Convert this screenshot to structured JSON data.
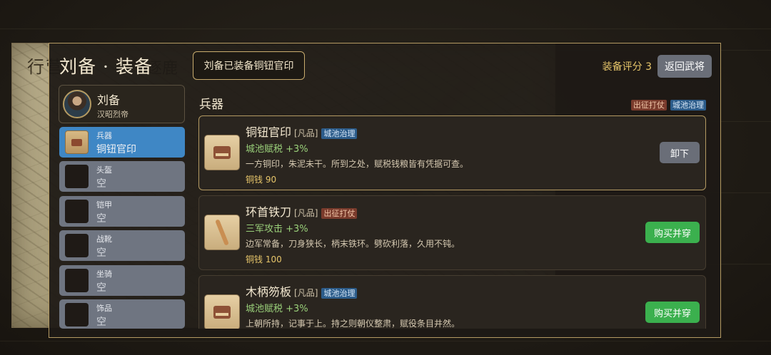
{
  "background": {
    "map_title": "行营",
    "map_title_tail": "逐鹿"
  },
  "header": {
    "title": "刘备 · 装备",
    "toast": "刘备已装备铜钮官印",
    "score_label": "装备评分 3",
    "back_label": "返回武将"
  },
  "hero": {
    "name": "刘备",
    "title": "汉昭烈帝"
  },
  "slots": [
    {
      "category": "兵器",
      "value": "铜钮官印",
      "active": true
    },
    {
      "category": "头盔",
      "value": "空",
      "active": false
    },
    {
      "category": "铠甲",
      "value": "空",
      "active": false
    },
    {
      "category": "战靴",
      "value": "空",
      "active": false
    },
    {
      "category": "坐骑",
      "value": "空",
      "active": false
    },
    {
      "category": "饰品",
      "value": "空",
      "active": false
    }
  ],
  "panel": {
    "section_title": "兵器",
    "legend": {
      "red": "出征打仗",
      "blue": "城池治理"
    }
  },
  "items": [
    {
      "name": "铜钮官印",
      "grade": "[凡品]",
      "tag": "城池治理",
      "effect": "城池赋税 +3%",
      "desc": "一方铜印，朱泥未干。所到之处，赋税钱粮皆有凭据可查。",
      "price": "铜钱 90",
      "button": "卸下"
    },
    {
      "name": "环首铁刀",
      "grade": "[凡品]",
      "tag": "出征打仗",
      "effect": "三军攻击 +3%",
      "desc": "边军常备，刀身狭长，柄末铁环。劈砍利落，久用不钝。",
      "price": "铜钱 100",
      "button": "购买并穿"
    },
    {
      "name": "木柄笏板",
      "grade": "[凡品]",
      "tag": "城池治理",
      "effect": "城池赋税 +3%",
      "desc": "上朝所持，记事于上。持之则朝仪整肃，赋役条目井然。",
      "price": "",
      "button": "购买并穿"
    }
  ],
  "colors": {
    "accent_gold": "#b49a62",
    "active_slot": "#3f87c5",
    "buy_green": "#3bb04e",
    "effect_green": "#9ad07a"
  }
}
